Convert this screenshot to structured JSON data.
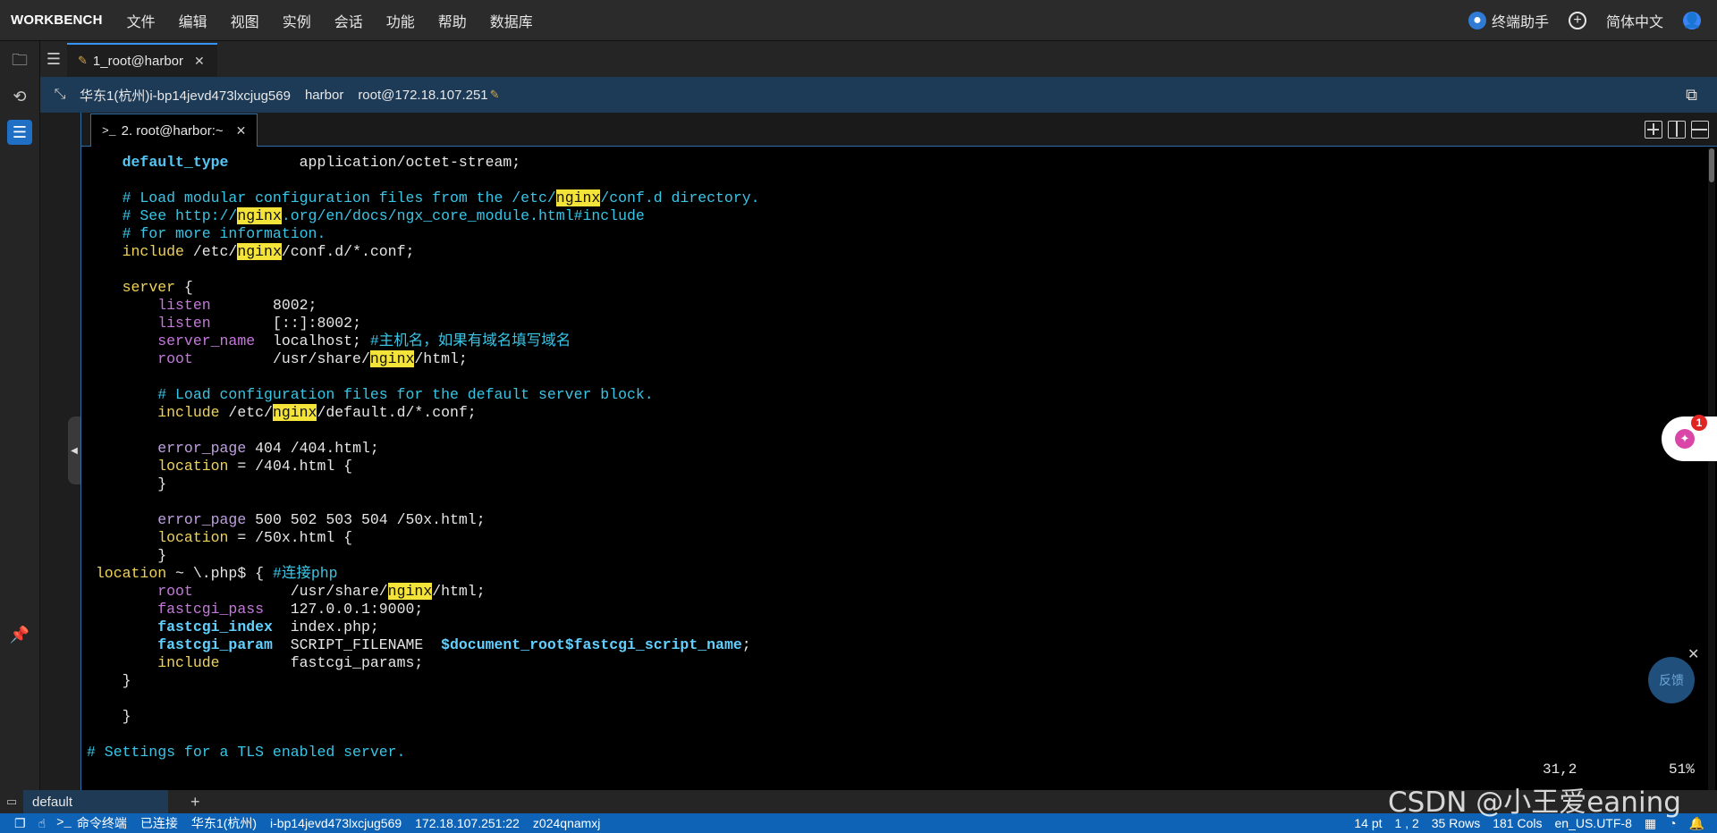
{
  "menubar": {
    "brand": "WORKBENCH",
    "items": [
      "文件",
      "编辑",
      "视图",
      "实例",
      "会话",
      "功能",
      "帮助",
      "数据库"
    ],
    "terminal_assistant": "终端助手",
    "language": "简体中文"
  },
  "session_tab": {
    "label": "1_root@harbor"
  },
  "hostbar": {
    "instance": "华东1(杭州)i-bp14jevd473lxcjug569",
    "hostname": "harbor",
    "login": "root@172.18.107.251"
  },
  "terminal_tab": {
    "label": "2. root@harbor:~"
  },
  "terminal": {
    "lines": [
      [
        {
          "t": "    "
        },
        {
          "t": "default_type",
          "c": "kw"
        },
        {
          "t": "        application/octet-stream;"
        }
      ],
      [
        {
          "t": ""
        }
      ],
      [
        {
          "t": "    # Load modular configuration files from the /etc/",
          "c": "cm"
        },
        {
          "t": "nginx",
          "c": "hl"
        },
        {
          "t": "/conf.d directory.",
          "c": "cm"
        }
      ],
      [
        {
          "t": "    # See http://",
          "c": "cm"
        },
        {
          "t": "nginx",
          "c": "hl"
        },
        {
          "t": ".org/en/docs/ngx_core_module.html#include",
          "c": "cm"
        }
      ],
      [
        {
          "t": "    # for more information.",
          "c": "cm"
        }
      ],
      [
        {
          "t": "    "
        },
        {
          "t": "include",
          "c": "yel"
        },
        {
          "t": " /etc/"
        },
        {
          "t": "nginx",
          "c": "hl"
        },
        {
          "t": "/conf.d/*.conf;"
        }
      ],
      [
        {
          "t": ""
        }
      ],
      [
        {
          "t": "    "
        },
        {
          "t": "server",
          "c": "yel"
        },
        {
          "t": " {"
        }
      ],
      [
        {
          "t": "        "
        },
        {
          "t": "listen",
          "c": "dir"
        },
        {
          "t": "       8002;"
        }
      ],
      [
        {
          "t": "        "
        },
        {
          "t": "listen",
          "c": "dir"
        },
        {
          "t": "       [::]:8002;"
        }
      ],
      [
        {
          "t": "        "
        },
        {
          "t": "server_name",
          "c": "dir"
        },
        {
          "t": "  localhost; "
        },
        {
          "t": "#主机名，如果有域名填写域名",
          "c": "zh"
        }
      ],
      [
        {
          "t": "        "
        },
        {
          "t": "root",
          "c": "dir"
        },
        {
          "t": "         /usr/share/"
        },
        {
          "t": "nginx",
          "c": "hl"
        },
        {
          "t": "/html;"
        }
      ],
      [
        {
          "t": ""
        }
      ],
      [
        {
          "t": "        # Load configuration files for the default server block.",
          "c": "cm"
        }
      ],
      [
        {
          "t": "        "
        },
        {
          "t": "include",
          "c": "yel"
        },
        {
          "t": " /etc/"
        },
        {
          "t": "nginx",
          "c": "hl"
        },
        {
          "t": "/default.d/*.conf;"
        }
      ],
      [
        {
          "t": ""
        }
      ],
      [
        {
          "t": "        "
        },
        {
          "t": "error_page",
          "c": "dir2"
        },
        {
          "t": " 404 /404.html;"
        }
      ],
      [
        {
          "t": "        "
        },
        {
          "t": "location",
          "c": "yel"
        },
        {
          "t": " = /404.html {"
        }
      ],
      [
        {
          "t": "        }"
        }
      ],
      [
        {
          "t": ""
        }
      ],
      [
        {
          "t": "        "
        },
        {
          "t": "error_page",
          "c": "dir2"
        },
        {
          "t": " 500 502 503 504 /50x.html;"
        }
      ],
      [
        {
          "t": "        "
        },
        {
          "t": "location",
          "c": "yel"
        },
        {
          "t": " = /50x.html {"
        }
      ],
      [
        {
          "t": "        }"
        }
      ],
      [
        {
          "t": " "
        },
        {
          "t": "location",
          "c": "yel"
        },
        {
          "t": " ~ \\.php$ { "
        },
        {
          "t": "#连接php",
          "c": "zh"
        }
      ],
      [
        {
          "t": "        "
        },
        {
          "t": "root",
          "c": "dir"
        },
        {
          "t": "           /usr/share/"
        },
        {
          "t": "nginx",
          "c": "hl"
        },
        {
          "t": "/html;"
        }
      ],
      [
        {
          "t": "        "
        },
        {
          "t": "fastcgi_pass",
          "c": "dir"
        },
        {
          "t": "   127.0.0.1:9000;"
        }
      ],
      [
        {
          "t": "        "
        },
        {
          "t": "fastcgi_index",
          "c": "bold-cy"
        },
        {
          "t": "  index.php;"
        }
      ],
      [
        {
          "t": "        "
        },
        {
          "t": "fastcgi_param",
          "c": "bold-cy"
        },
        {
          "t": "  SCRIPT_FILENAME  "
        },
        {
          "t": "$document_root$fastcgi_script_name",
          "c": "bold-cy"
        },
        {
          "t": ";"
        }
      ],
      [
        {
          "t": "        "
        },
        {
          "t": "include",
          "c": "yel"
        },
        {
          "t": "        fastcgi_params;"
        }
      ],
      [
        {
          "t": "    }"
        }
      ],
      [
        {
          "t": ""
        }
      ],
      [
        {
          "t": "    }"
        }
      ],
      [
        {
          "t": ""
        }
      ],
      [
        {
          "t": "# Settings for a TLS enabled server.",
          "c": "cm"
        }
      ]
    ],
    "cursor_position": "31,2",
    "scroll_percent": "51%"
  },
  "floating": {
    "badge_count": "1",
    "feedback_label": "反馈"
  },
  "bottom_panel": {
    "tab_label": "default"
  },
  "statusbar": {
    "terminal_label": "命令终端",
    "connection": "已连接",
    "region": "华东1(杭州)",
    "instance_id": "i-bp14jevd473lxcjug569",
    "address": "172.18.107.251:22",
    "user": "z024qnamxj",
    "font_size": "14 pt",
    "cursor": "1 , 2",
    "rows": "35 Rows",
    "cols": "181 Cols",
    "encoding": "en_US.UTF-8"
  },
  "watermark": "CSDN @小王爱eaning",
  "colors": {
    "status_bar": "#0e63b6",
    "host_bar": "#1d3a56",
    "highlight": "#f4e43a",
    "comment": "#39c5e6"
  }
}
